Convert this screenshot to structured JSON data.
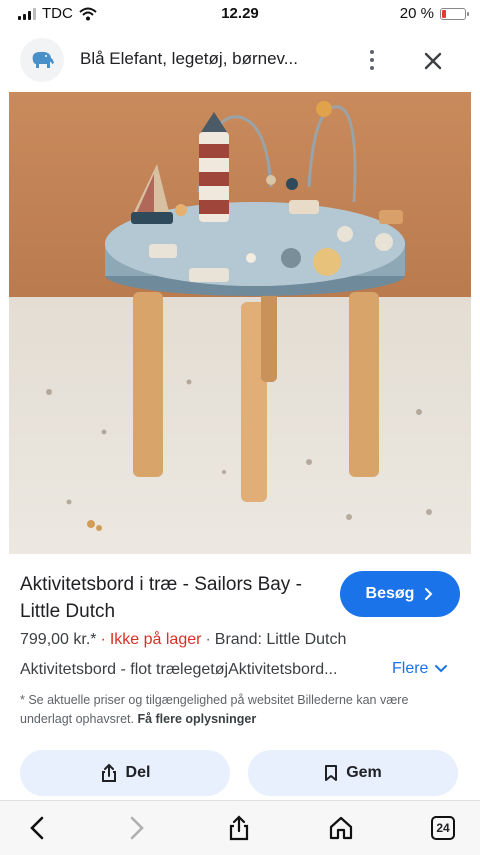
{
  "status_bar": {
    "carrier": "TDC",
    "time": "12.29",
    "battery_percent": "20 %",
    "battery_level": 0.2,
    "battery_color": "#e53935"
  },
  "tab": {
    "title": "Blå Elefant, legetøj, børnev...",
    "site_icon": "elephant-icon",
    "menu_icon": "more-vert-icon",
    "close_icon": "close-icon"
  },
  "product": {
    "title": "Aktivitetsbord i træ - Sailors Bay - Little Dutch",
    "price": "799,00 kr.*",
    "stock": "Ikke på lager",
    "brand": "Brand: Little Dutch",
    "description": "Aktivitetsbord - flot trælegetøjAktivitetsbord...",
    "more_label": "Flere",
    "disclaimer": "* Se aktuelle priser og tilgængelighed på websitet Billederne kan være underlagt ophavsret.",
    "more_info_label": "Få flere oplysninger"
  },
  "actions": {
    "visit_label": "Besøg",
    "share_label": "Del",
    "save_label": "Gem"
  },
  "toolbar": {
    "tabs_count": "24"
  },
  "colors": {
    "accent": "#1a73e8",
    "stock_red": "#d93025",
    "chip_bg": "#e8f0fe"
  }
}
